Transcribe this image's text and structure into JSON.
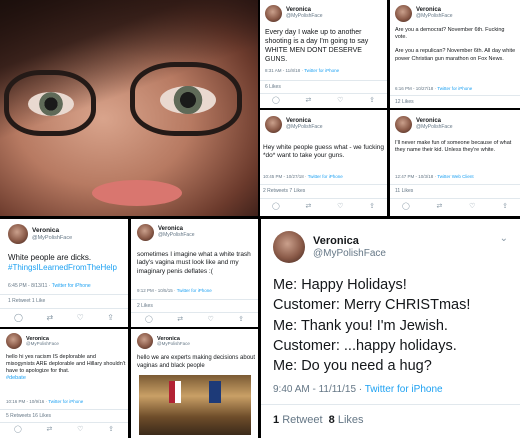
{
  "account": {
    "name": "Veronica",
    "handle": "@MyPolishFace"
  },
  "icons": {
    "chevron": "chevron-down-icon",
    "reply": "reply-icon",
    "retweet": "retweet-icon",
    "like": "heart-icon",
    "share": "share-icon"
  },
  "colors": {
    "link": "#1da1f2",
    "meta": "#657786",
    "divider": "#e1e8ed"
  },
  "tweets": {
    "t1": {
      "text": "Every day I wake up to another shooting is a day I'm going to say WHITE MEN DONT DESERVE GUNS.",
      "time": "8:31 AM - 11/8/18",
      "source": "Twitter for iPhone",
      "stats": "6 Likes"
    },
    "t2": {
      "text": "Are you a democrat? November 6th. Fucking vote.\n\nAre you a repulican? November 6th. All day white power Christian gun marathon on Fox News.",
      "time": "6:16 PM - 10/27/18",
      "source": "Twitter for iPhone",
      "stats": "12 Likes"
    },
    "t3": {
      "text": "Hey white people guess what - we fucking *do* want to take your guns.",
      "time": "10:45 PM - 10/27/18",
      "source": "Twitter for iPhone",
      "stats": "2 Retweets  7 Likes"
    },
    "t4": {
      "text": "I'll never make fun of someone because of what they name their kid. Unless they're white.",
      "time": "12:47 PM - 10/3/18",
      "source": "Twitter Web Client",
      "stats": "11 Likes"
    },
    "t5": {
      "text": "White people are dicks.",
      "hashtag": "#ThingsILearnedFromTheHelp",
      "time": "6:45 PM - 8/13/11",
      "source": "Twitter for iPhone",
      "stats": "1 Retweet  1 Like"
    },
    "t6": {
      "text": "sometimes I imagine what a white trash lady's vagina must look like and my imaginary penis deflates :(",
      "time": "9:12 PM - 10/5/15",
      "source": "Twitter for iPhone",
      "stats": "2 Likes"
    },
    "t7": {
      "text": "hello hi yes racism IS deplorable and misogynists ARE deplorable and Hillary shouldn't have to apologize for that.",
      "hashtag": "#debate",
      "time": "10:16 PM - 10/9/16",
      "source": "Twitter for iPhone",
      "stats": "5 Retweets  16 Likes"
    },
    "t8": {
      "text": "hello we are experts making decisions about vaginas and black people"
    },
    "t9": {
      "text": "Me: Happy Holidays!\nCustomer: Merry CHRISTmas!\nMe: Thank you! I'm Jewish.\nCustomer: ...happy holidays.\nMe: Do you need a hug?",
      "time": "9:40 AM - 11/11/15",
      "source": "Twitter for iPhone",
      "stats_num1": "1",
      "stats_lbl1": "Retweet",
      "stats_num2": "8",
      "stats_lbl2": "Likes"
    }
  }
}
